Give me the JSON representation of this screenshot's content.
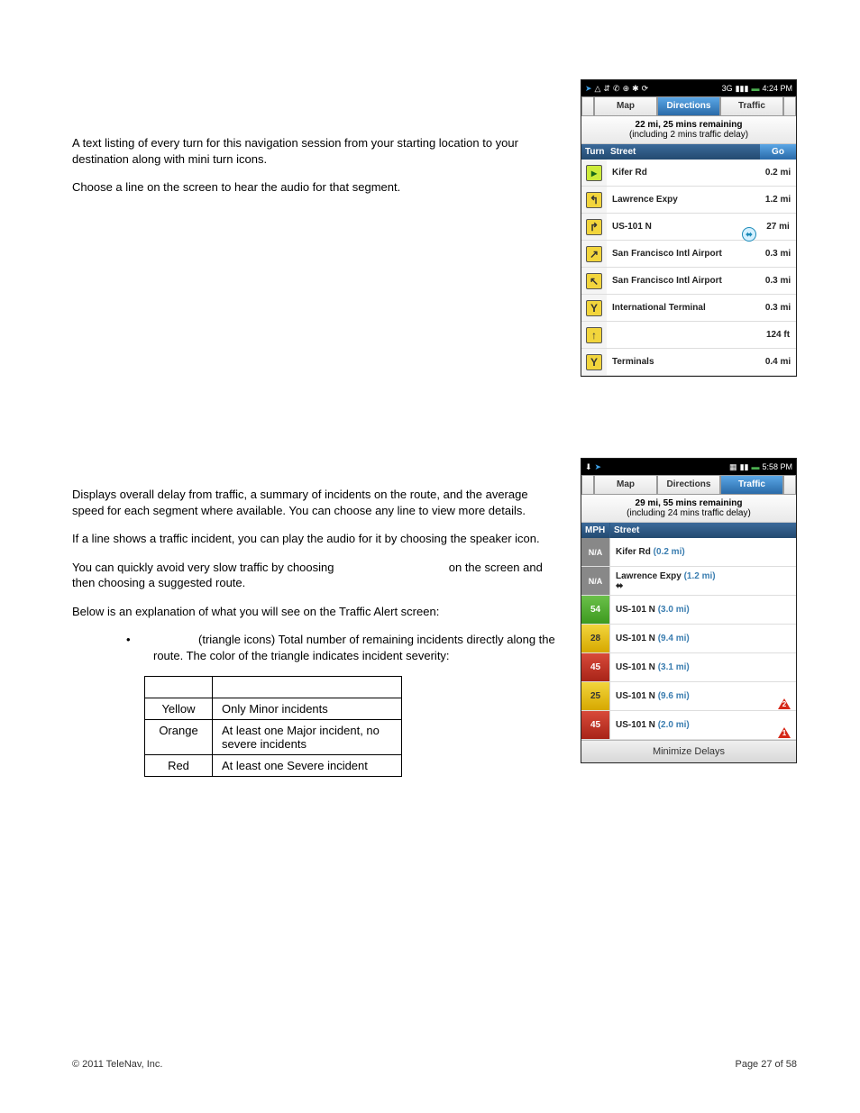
{
  "section1": {
    "p1": "A text listing of every turn for this navigation session from your starting location to your destination along with mini turn icons.",
    "p2": "Choose a line on the screen to hear the audio for that segment."
  },
  "section2": {
    "p1": "Displays overall delay from traffic, a summary of incidents on the route, and the average speed for each segment where available. You can choose any line to view more details.",
    "p2": "If a line shows a traffic incident, you can play the audio for it by choosing the speaker icon.",
    "p3a": "You can quickly avoid very slow traffic by choosing",
    "p3b": "on the screen and then choosing a suggested route.",
    "p4": "Below is an explanation of what you will see on the Traffic Alert screen:",
    "bullet": "(triangle icons)    Total number of remaining incidents directly along the route. The color of the triangle indicates incident severity:"
  },
  "severity": {
    "rows": [
      {
        "color": "Yellow",
        "desc": "Only Minor incidents"
      },
      {
        "color": "Orange",
        "desc": "At least one Major incident, no severe incidents"
      },
      {
        "color": "Red",
        "desc": "At least one Severe incident"
      }
    ]
  },
  "phone1": {
    "time": "4:24 PM",
    "tabs": {
      "map": "Map",
      "directions": "Directions",
      "traffic": "Traffic"
    },
    "summary_line1": "22 mi, 25 mins remaining",
    "summary_line2": "(including 2 mins traffic delay)",
    "head": {
      "turn": "Turn",
      "street": "Street",
      "go": "Go"
    },
    "rows": [
      {
        "icon_bg": "#cdeb3a",
        "icon_fg": "#1a6a1a",
        "glyph": "▸",
        "street": "Kifer Rd",
        "dist": "0.2 mi",
        "badge": false
      },
      {
        "icon_bg": "#f2d53c",
        "icon_fg": "#333",
        "glyph": "↰",
        "street": "Lawrence Expy",
        "dist": "1.2 mi",
        "badge": false
      },
      {
        "icon_bg": "#f2d53c",
        "icon_fg": "#333",
        "glyph": "↱",
        "street": "US-101 N",
        "dist": "27 mi",
        "badge": true
      },
      {
        "icon_bg": "#f2d53c",
        "icon_fg": "#333",
        "glyph": "↗",
        "street": "San Francisco Intl Airport",
        "dist": "0.3 mi",
        "badge": false
      },
      {
        "icon_bg": "#f2d53c",
        "icon_fg": "#333",
        "glyph": "↖",
        "street": "San Francisco Intl Airport",
        "dist": "0.3 mi",
        "badge": false
      },
      {
        "icon_bg": "#f2d53c",
        "icon_fg": "#333",
        "glyph": "Y",
        "street": "International Terminal",
        "dist": "0.3 mi",
        "badge": false
      },
      {
        "icon_bg": "#f2d53c",
        "icon_fg": "#333",
        "glyph": "↑",
        "street": "",
        "dist": "124 ft",
        "badge": false
      },
      {
        "icon_bg": "#f2d53c",
        "icon_fg": "#333",
        "glyph": "Y",
        "street": "Terminals",
        "dist": "0.4 mi",
        "badge": false
      }
    ]
  },
  "phone2": {
    "time": "5:58 PM",
    "tabs": {
      "map": "Map",
      "directions": "Directions",
      "traffic": "Traffic"
    },
    "summary_line1": "29 mi, 55 mins remaining",
    "summary_line2": "(including 24 mins traffic delay)",
    "head": {
      "mph": "MPH",
      "street": "Street"
    },
    "rows": [
      {
        "mph": "N/A",
        "cls": "na",
        "street": "Kifer Rd",
        "dist": "(0.2 mi)",
        "tri": "",
        "num": "",
        "badge": false
      },
      {
        "mph": "N/A",
        "cls": "na",
        "street": "Lawrence Expy",
        "dist": "(1.2 mi)",
        "tri": "",
        "num": "",
        "badge": true
      },
      {
        "mph": "54",
        "cls": "green",
        "street": "US-101 N",
        "dist": "(3.0 mi)",
        "tri": "",
        "num": "",
        "badge": false
      },
      {
        "mph": "28",
        "cls": "yellow",
        "street": "US-101 N",
        "dist": "(9.4 mi)",
        "tri": "",
        "num": "",
        "badge": false
      },
      {
        "mph": "45",
        "cls": "red",
        "street": "US-101 N",
        "dist": "(3.1 mi)",
        "tri": "",
        "num": "",
        "badge": false
      },
      {
        "mph": "25",
        "cls": "yellow",
        "street": "US-101 N",
        "dist": "(9.6 mi)",
        "tri": "red",
        "num": "2",
        "badge": false
      },
      {
        "mph": "45",
        "cls": "red",
        "street": "US-101 N",
        "dist": "(2.0 mi)",
        "tri": "red",
        "num": "1",
        "badge": false
      }
    ],
    "minimize": "Minimize Delays"
  },
  "footer": {
    "copyright": "© 2011 TeleNav, Inc.",
    "page": "Page 27 of 58"
  }
}
